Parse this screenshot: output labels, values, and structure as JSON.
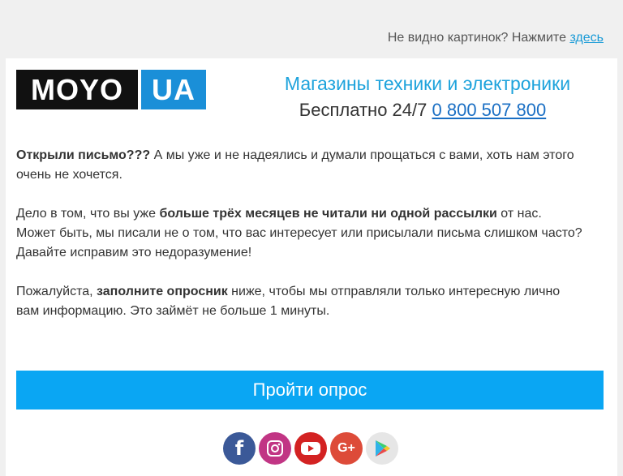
{
  "top_notice": {
    "text": "Не видно картинок? Нажмите",
    "link": "здесь"
  },
  "logo": {
    "left": "MOYO",
    "right": "UA"
  },
  "header": {
    "tagline": "Магазины техники и электроники",
    "phone_prefix": "Бесплатно 24/7",
    "phone_number": "0 800 507 800"
  },
  "body": {
    "p1_bold": "Открыли письмо???",
    "p1_rest": " А мы уже и не надеялись и думали прощаться с вами, хоть нам этого очень не хочется.",
    "p2_start": "Дело в том, что вы уже ",
    "p2_bold": "больше трёх месяцев не читали ни одной рассылки",
    "p2_end": " от нас. Может быть, мы писали не о том, что вас интересует или присылали письма слишком часто? Давайте исправим это недоразумение!",
    "p3_start": "Пожалуйста, ",
    "p3_bold": "заполните опросник",
    "p3_end": " ниже, чтобы мы отправляли только интересную лично вам информацию. Это займёт не больше 1 минуты."
  },
  "cta": {
    "label": "Пройти опрос"
  },
  "socials": {
    "facebook_glyph": "f",
    "googleplus_glyph": "G+"
  },
  "colors": {
    "accent": "#0aa6f3",
    "brand_blue": "#1a8fd8",
    "link": "#1a6fc4"
  }
}
